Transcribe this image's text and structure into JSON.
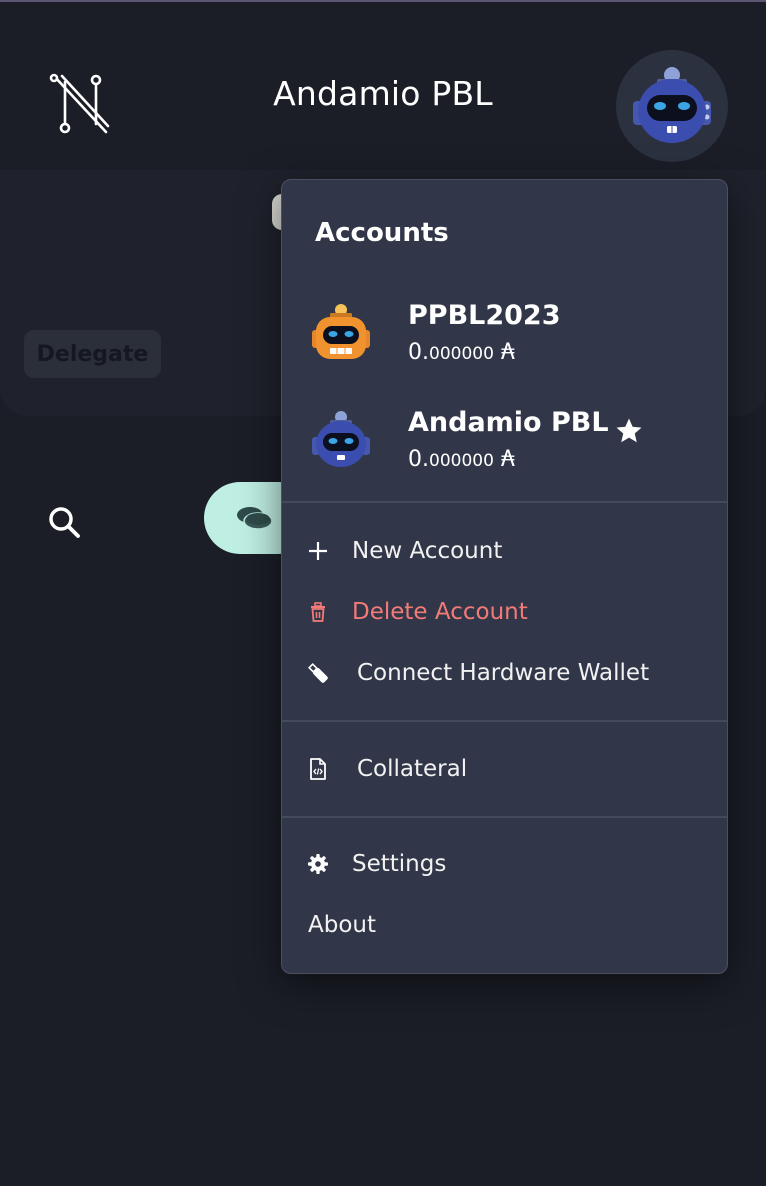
{
  "header": {
    "title": "Andamio PBL",
    "logo_icon": "nami-logo-icon",
    "avatar_icon": "robot-avatar-blue-icon"
  },
  "background": {
    "delegate_label": "Delegate",
    "search_icon": "search-icon",
    "assets_icon": "coins-icon"
  },
  "menu": {
    "heading": "Accounts",
    "accounts": [
      {
        "name": "PPBL2023",
        "balance_int": "0.",
        "balance_dec": "000000",
        "unit": "₳",
        "avatar": "robot-avatar-orange-icon",
        "active": false
      },
      {
        "name": "Andamio PBL",
        "balance_int": "0.",
        "balance_dec": "000000",
        "unit": "₳",
        "avatar": "robot-avatar-blue-icon",
        "active": true
      }
    ],
    "items": {
      "new_account": "New Account",
      "delete_account": "Delete Account",
      "connect_hw": "Connect Hardware Wallet",
      "collateral": "Collateral",
      "settings": "Settings",
      "about": "About"
    }
  },
  "colors": {
    "background": "#1b1e27",
    "menu_bg": "#313748",
    "danger": "#f47a78",
    "accent_mint": "#bfeee2",
    "robot_blue": "#3c4db0",
    "robot_orange": "#f0922e"
  }
}
